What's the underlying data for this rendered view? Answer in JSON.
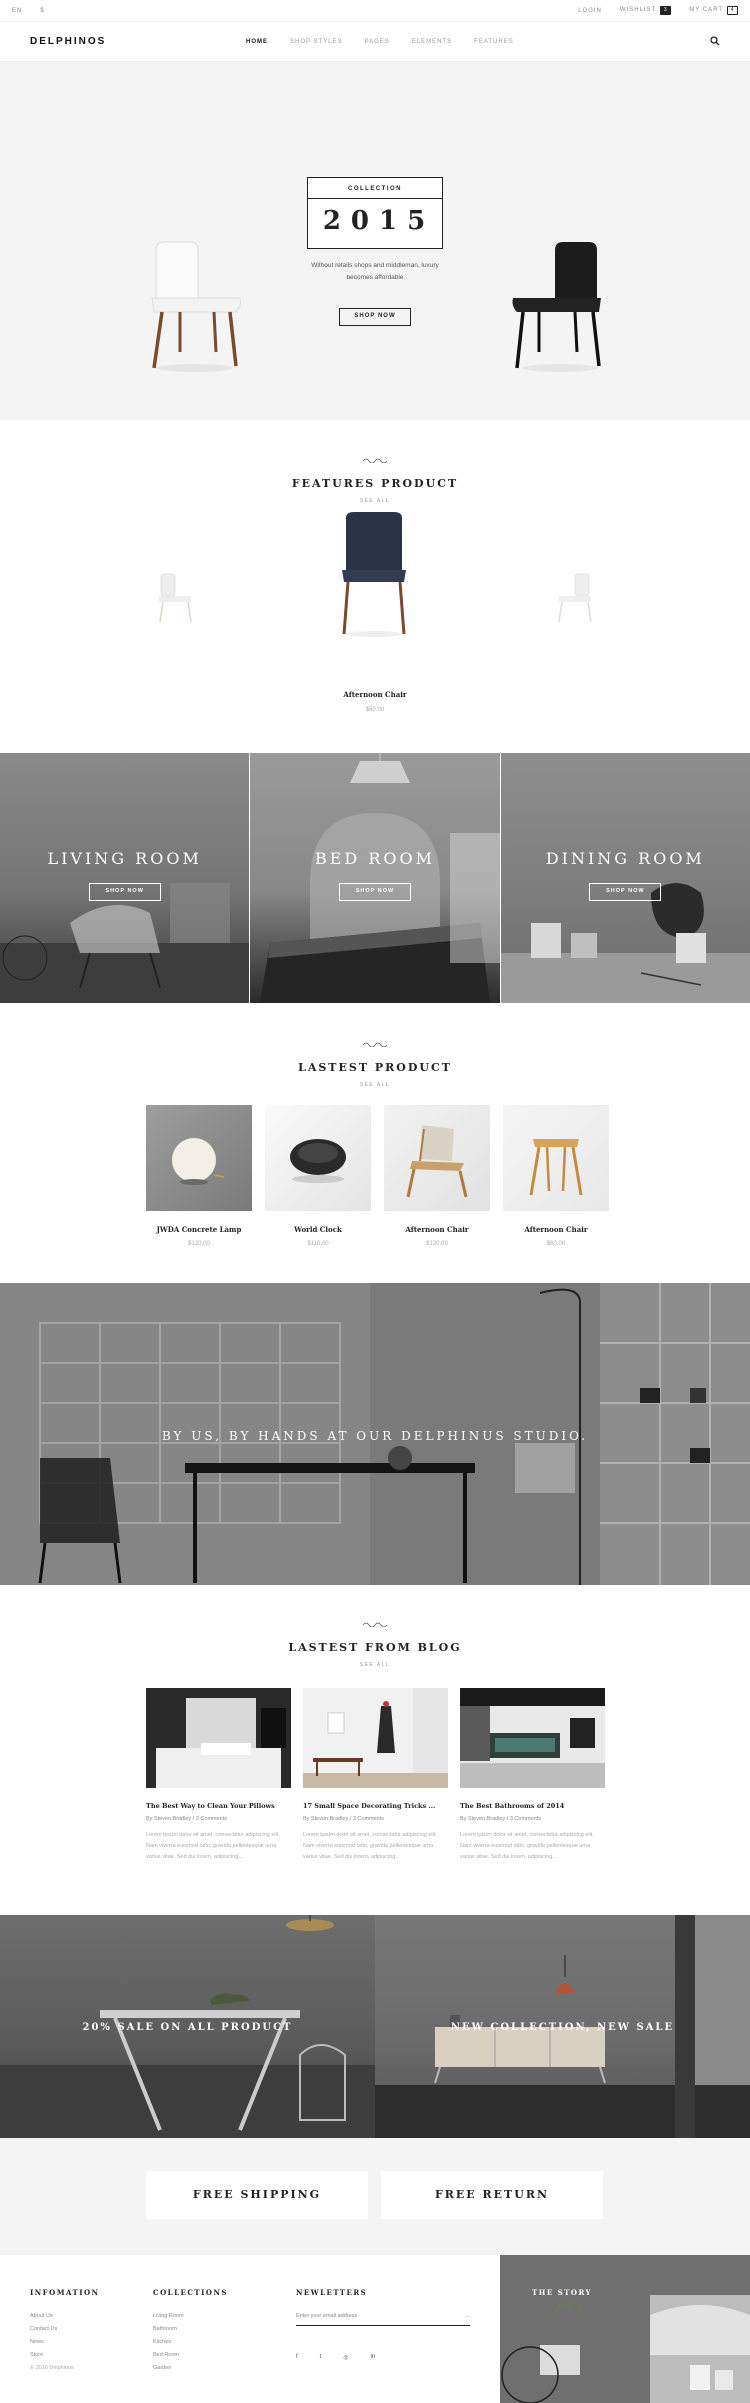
{
  "topbar": {
    "lang": "EN",
    "currency": "$",
    "login": "LOGIN",
    "wishlist": "WISHLIST",
    "wishlist_count": "3",
    "cart": "MY CART",
    "cart_count": "4"
  },
  "nav": {
    "logo": "DELPHINOS",
    "items": [
      "HOME",
      "SHOP STYLES",
      "PAGES",
      "ELEMENTS",
      "FEATURES"
    ]
  },
  "hero": {
    "collection": "COLLECTION",
    "year": "2015",
    "desc_line1": "Without retails shops and middleman, luxury",
    "desc_line2": "becomes affordable",
    "button": "SHOP NOW"
  },
  "features": {
    "title": "FEATURES PRODUCT",
    "see_all": "SEE ALL",
    "product_name": "Afternoon Chair",
    "product_price": "$60.00"
  },
  "rooms": [
    {
      "title": "LIVING ROOM",
      "button": "SHOP NOW"
    },
    {
      "title": "BED ROOM",
      "button": "SHOP NOW"
    },
    {
      "title": "DINING ROOM",
      "button": "SHOP NOW"
    }
  ],
  "latest": {
    "title": "LASTEST PRODUCT",
    "see_all": "SEE ALL",
    "products": [
      {
        "name": "JWDA Concrete Lamp",
        "price": "$120.00"
      },
      {
        "name": "World Clock",
        "price": "$110.00"
      },
      {
        "name": "Afternoon Chair",
        "price": "$120.00"
      },
      {
        "name": "Afternoon Chair",
        "price": "$60.00"
      }
    ]
  },
  "studio": {
    "title": "BY US, BY HANDS AT OUR DELPHINUS STUDIO."
  },
  "blog": {
    "title": "LASTEST FROM BLOG",
    "see_all": "SEE ALL",
    "posts": [
      {
        "title": "The Best Way to Clean Your Pillows",
        "meta": "By Steven Bradley / 3 Comments",
        "excerpt": "Lorem ipsum dolor sit amet, consectetur adipiscing elit. Nam viverra euismod odio, gravida pellentesque urna varius vitae. Sed dui lorem, adipiscing..."
      },
      {
        "title": "17 Small Space Decorating Tricks ...",
        "meta": "By Steven Bradley / 3 Comments",
        "excerpt": "Lorem ipsum dolor sit amet, consectetur adipiscing elit. Nam viverra euismod odio, gravida pellentesque urna varius vitae. Sed dui lorem, adipiscing..."
      },
      {
        "title": "The Best Bathrooms of 2014",
        "meta": "By Steven Bradley / 3 Comments",
        "excerpt": "Lorem ipsum dolor sit amet, consectetur adipiscing elit. Nam viverra euismod odio, gravida pellentesque urna varius vitae. Sed dui lorem, adipiscing..."
      }
    ]
  },
  "sales": [
    {
      "title": "20% SALE ON ALL PRODUCT"
    },
    {
      "title": "NEW COLLECTION, NEW SALE"
    }
  ],
  "shipping": {
    "free_shipping": "FREE SHIPPING",
    "free_return": "FREE RETURN"
  },
  "footer": {
    "info_title": "INFOMATION",
    "info_links": [
      "About Us",
      "Contact Us",
      "News",
      "Store"
    ],
    "copyright": "© 2016 Delphinus",
    "collections_title": "COLLECTIONS",
    "collection_links": [
      "Living Room",
      "Bathroom",
      "Kitchen",
      "Bed Room",
      "Garden"
    ],
    "newsletter_title": "NEWLETTERS",
    "newsletter_placeholder": "Enter your email address",
    "newsletter_arrow": "→",
    "socials": [
      "f",
      "t",
      "◎",
      "in"
    ],
    "story_title": "THE STORY"
  }
}
